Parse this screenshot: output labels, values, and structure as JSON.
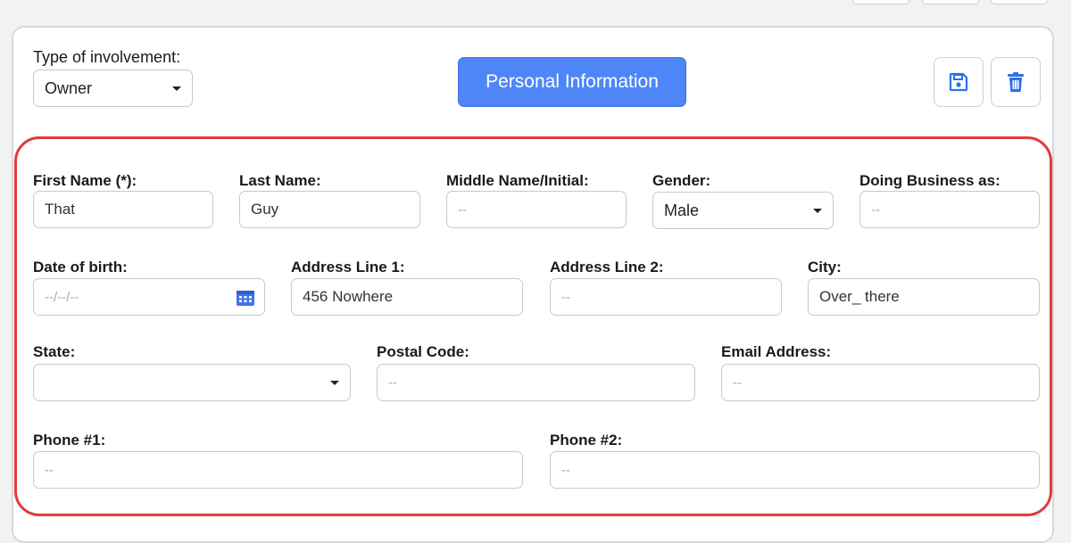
{
  "involvement": {
    "label": "Type of involvement:",
    "value": "Owner"
  },
  "header": {
    "section_button": "Personal Information",
    "save_icon": "floppy-disk-icon",
    "delete_icon": "trash-icon"
  },
  "form": {
    "first_name": {
      "label": "First Name (*):",
      "value": "That"
    },
    "last_name": {
      "label": "Last Name:",
      "value": "Guy"
    },
    "middle_name": {
      "label": "Middle Name/Initial:",
      "placeholder": "--"
    },
    "gender": {
      "label": "Gender:",
      "value": "Male"
    },
    "dba": {
      "label": "Doing Business as:",
      "placeholder": "--"
    },
    "dob": {
      "label": "Date of birth:",
      "placeholder": "--/--/--",
      "icon": "calendar-icon"
    },
    "address1": {
      "label": "Address Line 1:",
      "value": "456 Nowhere"
    },
    "address2": {
      "label": "Address Line 2:",
      "placeholder": "--"
    },
    "city": {
      "label": "City:",
      "value": "Over_ there"
    },
    "state": {
      "label": "State:",
      "value": ""
    },
    "postal_code": {
      "label": "Postal Code:",
      "placeholder": "--"
    },
    "email": {
      "label": "Email Address:",
      "placeholder": "--"
    },
    "phone1": {
      "label": "Phone #1:",
      "placeholder": "--"
    },
    "phone2": {
      "label": "Phone #2:",
      "placeholder": "--"
    }
  },
  "colors": {
    "primary": "#4f86f7",
    "highlight": "#e23b3b",
    "icon_blue": "#2f6fe8"
  }
}
